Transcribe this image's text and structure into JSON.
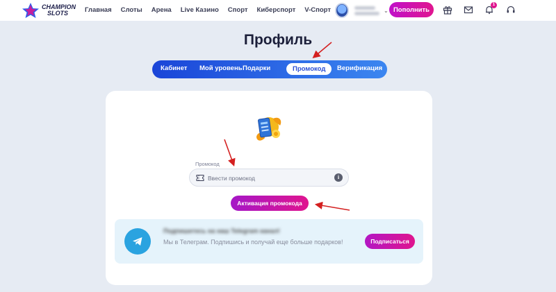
{
  "header": {
    "logo_line1": "CHAMPION",
    "logo_line2": "SLOTS",
    "nav": [
      "Главная",
      "Слоты",
      "Арена",
      "Live Казино",
      "Спорт",
      "Киберспорт",
      "V-Спорт"
    ],
    "deposit_label": "Пополнить",
    "notification_count": "1",
    "icons": [
      "gift-icon",
      "mail-icon",
      "bell-icon",
      "headset-icon"
    ]
  },
  "page": {
    "title": "Профиль",
    "tabs": [
      {
        "label": "Кабинет",
        "active": false
      },
      {
        "label": "Мой уровень",
        "active": false
      },
      {
        "label": "Подарки",
        "active": false
      },
      {
        "label": "Промокод",
        "active": true
      },
      {
        "label": "Верификация",
        "active": false
      }
    ]
  },
  "promo": {
    "field_label": "Промокод",
    "placeholder": "Ввести промокод",
    "value": "",
    "activate_label": "Активация промокода"
  },
  "telegram": {
    "title": "Подпишитесь на наш Telegram канал!",
    "text": "Мы в Телеграм. Подпишись и получай еще больше подарков!",
    "subscribe_label": "Подписаться"
  },
  "colors": {
    "background": "#e6ebf3",
    "accent_gradient_start": "#c011c9",
    "accent_gradient_end": "#e0158f",
    "tabs_gradient_start": "#1a45d8",
    "tabs_gradient_end": "#3b86f0",
    "telegram_blue": "#2aa3e0",
    "annotation_arrow": "#d42020"
  }
}
